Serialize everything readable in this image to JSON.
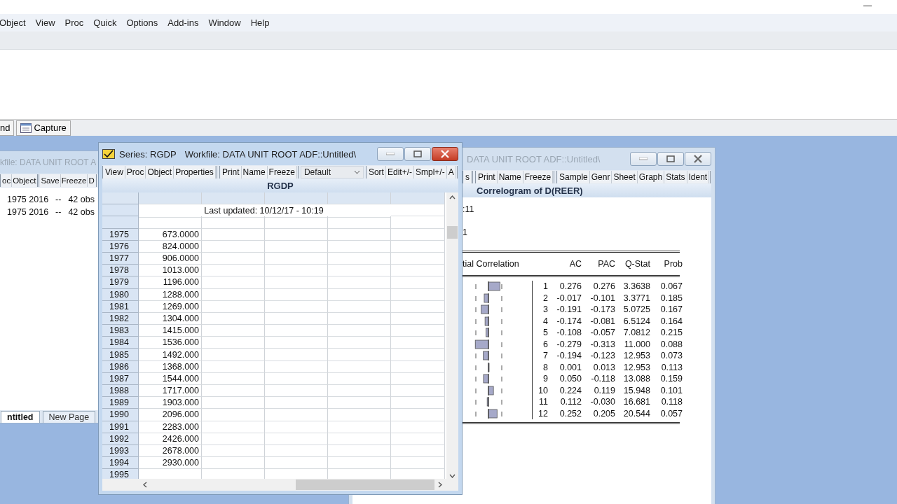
{
  "menu_bar": {
    "items": [
      "Object",
      "View",
      "Proc",
      "Quick",
      "Options",
      "Add-ins",
      "Window",
      "Help"
    ]
  },
  "command_bar": {
    "buttons": [
      {
        "label": "nd",
        "kind": "plain"
      },
      {
        "label": "Capture",
        "kind": "icon"
      }
    ]
  },
  "workfile_window": {
    "title": "kfile: DATA UNIT ROOT A",
    "toolbar_groups": [
      [
        "oc",
        "Object"
      ],
      [
        "Save",
        "Freeze",
        "D"
      ]
    ],
    "rows": [
      {
        "range": "1975 2016",
        "dash": "--",
        "obs": "42 obs"
      },
      {
        "range": "1975 2016",
        "dash": "--",
        "obs": "42 obs"
      }
    ],
    "tabs": [
      {
        "label": "ntitled",
        "selected": true
      },
      {
        "label": "New Page",
        "selected": false
      }
    ]
  },
  "correlogram_window": {
    "title": "DATA UNIT ROOT ADF::Untitled\\",
    "toolbar_groups": [
      [
        "s"
      ],
      [
        "Print",
        "Name",
        "Freeze"
      ],
      [
        "Sample",
        "Genr",
        "Sheet",
        "Graph",
        "Stats",
        "Ident"
      ]
    ],
    "heading": "Correlogram of D(REER)",
    "lines": [
      ":11",
      "1"
    ],
    "columns": [
      "tial Correlation",
      "AC",
      "PAC",
      "Q-Stat",
      "Prob"
    ],
    "rows": [
      {
        "lag": "1",
        "ac": "0.276",
        "pac": "0.276",
        "q_stat": "3.3638",
        "prob": "0.067"
      },
      {
        "lag": "2",
        "ac": "-0.017",
        "pac": "-0.101",
        "q_stat": "3.3771",
        "prob": "0.185"
      },
      {
        "lag": "3",
        "ac": "-0.191",
        "pac": "-0.173",
        "q_stat": "5.0725",
        "prob": "0.167"
      },
      {
        "lag": "4",
        "ac": "-0.174",
        "pac": "-0.081",
        "q_stat": "6.5124",
        "prob": "0.164"
      },
      {
        "lag": "5",
        "ac": "-0.108",
        "pac": "-0.057",
        "q_stat": "7.0812",
        "prob": "0.215"
      },
      {
        "lag": "6",
        "ac": "-0.279",
        "pac": "-0.313",
        "q_stat": "11.000",
        "prob": "0.088"
      },
      {
        "lag": "7",
        "ac": "-0.194",
        "pac": "-0.123",
        "q_stat": "12.953",
        "prob": "0.073"
      },
      {
        "lag": "8",
        "ac": "0.001",
        "pac": "0.013",
        "q_stat": "12.953",
        "prob": "0.113"
      },
      {
        "lag": "9",
        "ac": "0.050",
        "pac": "-0.118",
        "q_stat": "13.088",
        "prob": "0.159"
      },
      {
        "lag": "10",
        "ac": "0.224",
        "pac": "0.119",
        "q_stat": "15.948",
        "prob": "0.101"
      },
      {
        "lag": "11",
        "ac": "0.112",
        "pac": "-0.030",
        "q_stat": "16.681",
        "prob": "0.118"
      },
      {
        "lag": "12",
        "ac": "0.252",
        "pac": "0.205",
        "q_stat": "20.544",
        "prob": "0.057"
      }
    ]
  },
  "series_window": {
    "title": "Series: RGDP",
    "workfile": "Workfile: DATA UNIT ROOT ADF::Untitled\\",
    "toolbar_groups": [
      [
        "View",
        "Proc",
        "Object",
        "Properties"
      ],
      [
        "Print",
        "Name",
        "Freeze"
      ]
    ],
    "view_select": "Default",
    "toolbar_groups_right": [
      [
        "Sort",
        "Edit+/-",
        "Smpl+/-",
        "A"
      ]
    ],
    "heading": "RGDP",
    "note": "Last updated: 10/12/17 - 10:19",
    "rows": [
      {
        "year": "1975",
        "value": "673.0000"
      },
      {
        "year": "1976",
        "value": "824.0000"
      },
      {
        "year": "1977",
        "value": "906.0000"
      },
      {
        "year": "1978",
        "value": "1013.000"
      },
      {
        "year": "1979",
        "value": "1196.000"
      },
      {
        "year": "1980",
        "value": "1288.000"
      },
      {
        "year": "1981",
        "value": "1269.000"
      },
      {
        "year": "1982",
        "value": "1304.000"
      },
      {
        "year": "1983",
        "value": "1415.000"
      },
      {
        "year": "1984",
        "value": "1536.000"
      },
      {
        "year": "1985",
        "value": "1492.000"
      },
      {
        "year": "1986",
        "value": "1368.000"
      },
      {
        "year": "1987",
        "value": "1544.000"
      },
      {
        "year": "1988",
        "value": "1717.000"
      },
      {
        "year": "1989",
        "value": "1903.000"
      },
      {
        "year": "1990",
        "value": "2096.000"
      },
      {
        "year": "1991",
        "value": "2283.000"
      },
      {
        "year": "1992",
        "value": "2426.000"
      },
      {
        "year": "1993",
        "value": "2678.000"
      },
      {
        "year": "1994",
        "value": "2930.000"
      },
      {
        "year": "1995"
      }
    ]
  }
}
